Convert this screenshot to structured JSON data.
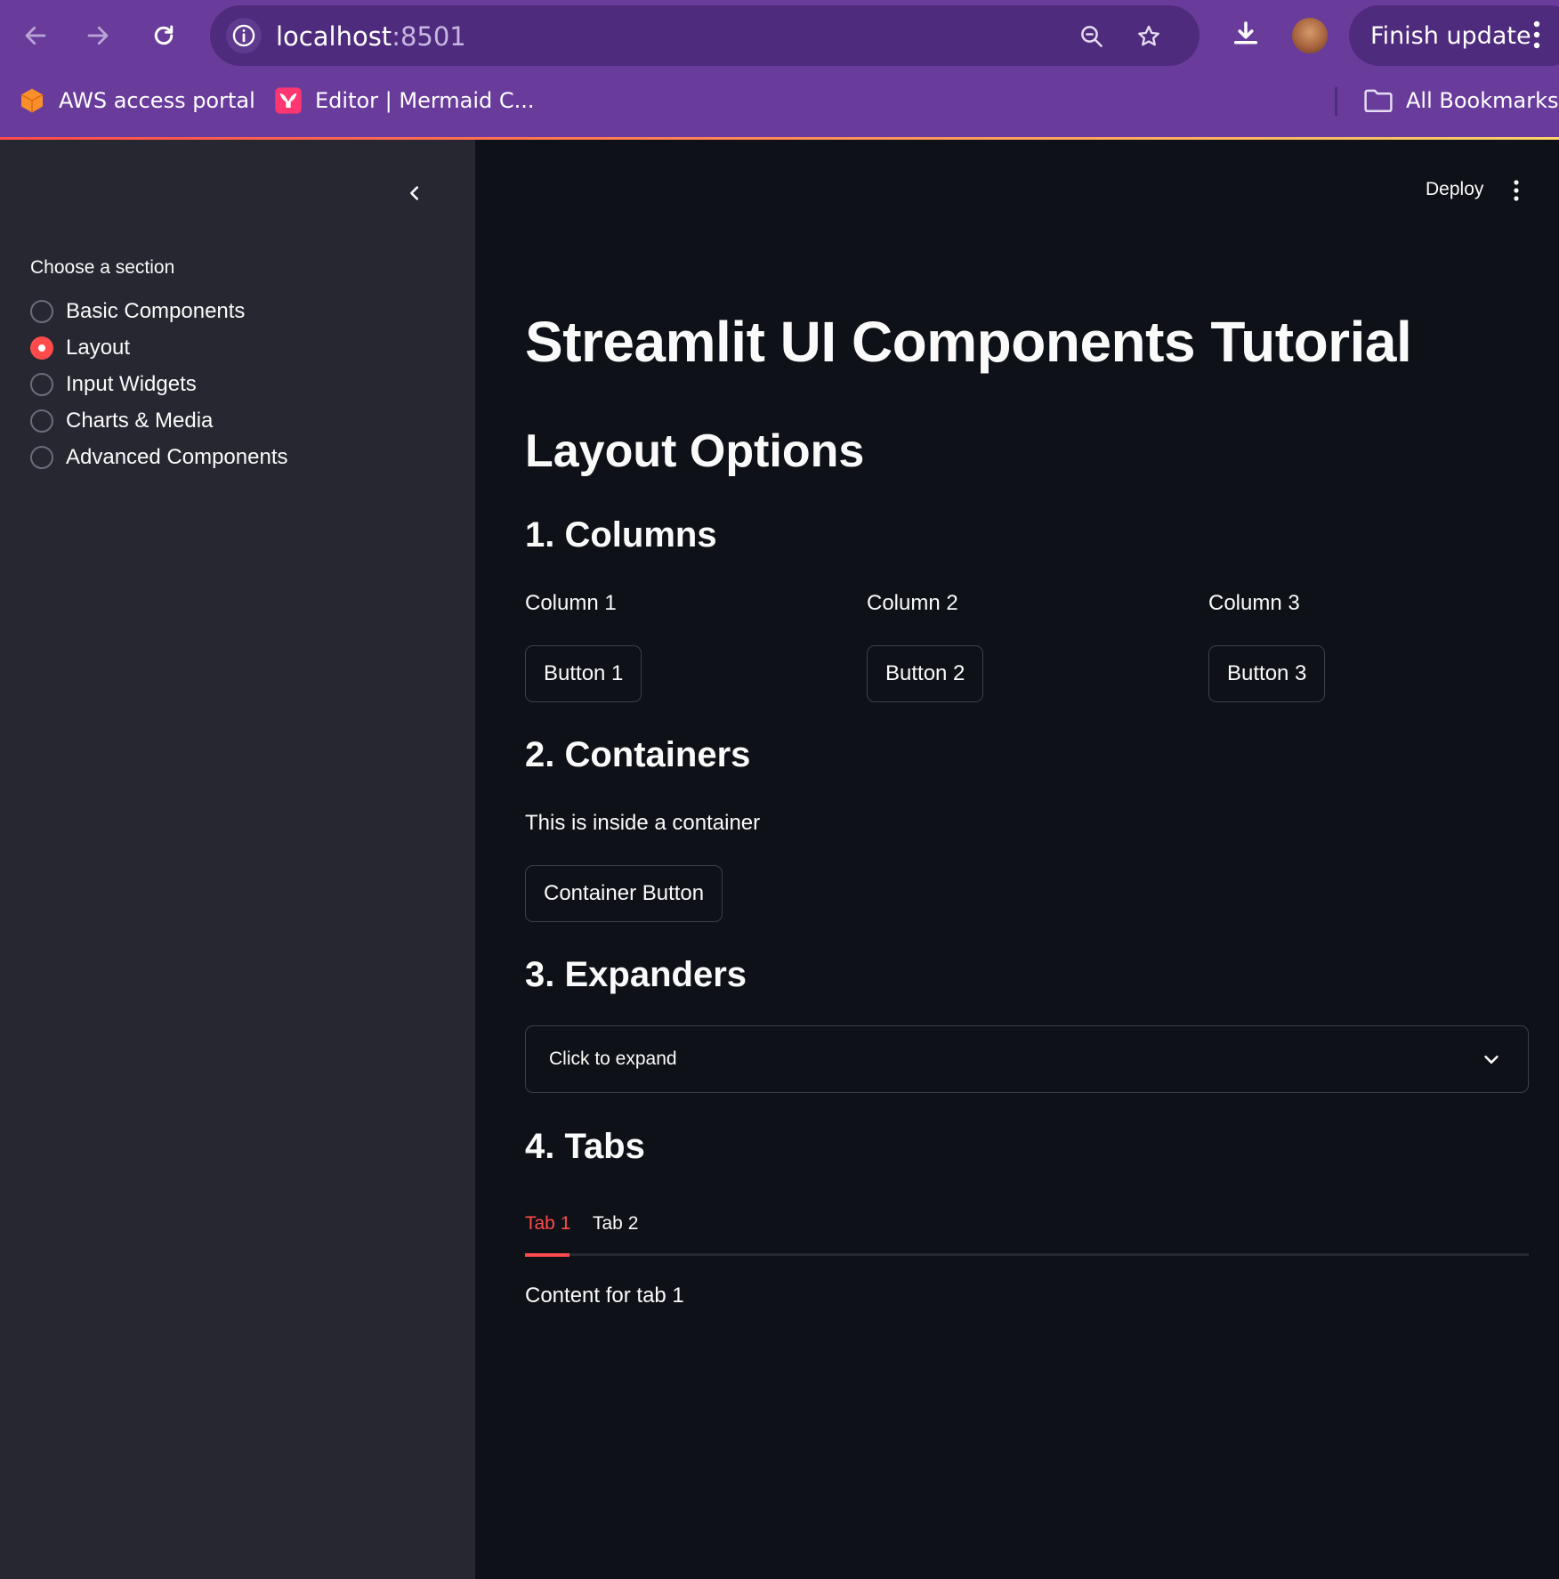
{
  "browser": {
    "url_host": "localhost",
    "url_port": ":8501",
    "finish_update_label": "Finish update",
    "bookmarks": [
      {
        "label": "AWS access portal"
      },
      {
        "label": "Editor | Mermaid C..."
      }
    ],
    "all_bookmarks_label": "All Bookmarks"
  },
  "sidebar": {
    "section_label": "Choose a section",
    "options": [
      {
        "label": "Basic Components",
        "selected": false
      },
      {
        "label": "Layout",
        "selected": true
      },
      {
        "label": "Input Widgets",
        "selected": false
      },
      {
        "label": "Charts & Media",
        "selected": false
      },
      {
        "label": "Advanced Components",
        "selected": false
      }
    ]
  },
  "header": {
    "deploy_label": "Deploy"
  },
  "main": {
    "title": "Streamlit UI Components Tutorial",
    "subtitle": "Layout Options",
    "columns": {
      "heading": "1. Columns",
      "items": [
        {
          "label": "Column 1",
          "button": "Button 1"
        },
        {
          "label": "Column 2",
          "button": "Button 2"
        },
        {
          "label": "Column 3",
          "button": "Button 3"
        }
      ]
    },
    "containers": {
      "heading": "2. Containers",
      "text": "This is inside a container",
      "button": "Container Button"
    },
    "expanders": {
      "heading": "3. Expanders",
      "label": "Click to expand"
    },
    "tabs": {
      "heading": "4. Tabs",
      "items": [
        {
          "label": "Tab 1",
          "active": true
        },
        {
          "label": "Tab 2",
          "active": false
        }
      ],
      "content": "Content for tab 1"
    }
  },
  "colors": {
    "accent": "#ff4b4b",
    "chrome": "#693c9c",
    "sidebar_bg": "#262730",
    "main_bg": "#0e1117"
  }
}
